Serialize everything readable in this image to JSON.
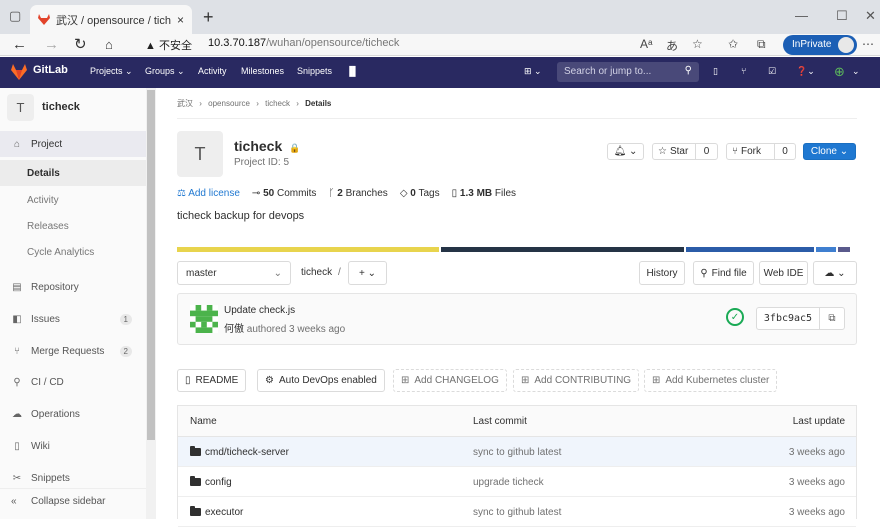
{
  "browser": {
    "tab_title": "武汉 / opensource / ticheck · Git",
    "tab_close": "×",
    "new_tab": "+",
    "security_label": "不安全",
    "url_host": "10.3.70.187",
    "url_path": "/wuhan/opensource/ticheck",
    "inprivate_label": "InPrivate"
  },
  "header": {
    "brand": "GitLab",
    "projects": "Projects ⌄",
    "groups": "Groups ⌄",
    "activity": "Activity",
    "milestones": "Milestones",
    "snippets": "Snippets",
    "search_placeholder": "Search or jump to..."
  },
  "sidebar": {
    "project_initial": "T",
    "project_name": "ticheck",
    "project": "Project",
    "details": "Details",
    "activity": "Activity",
    "releases": "Releases",
    "cycle_analytics": "Cycle Analytics",
    "repository": "Repository",
    "issues": "Issues",
    "issues_count": "1",
    "merge_requests": "Merge Requests",
    "merge_requests_count": "2",
    "ci_cd": "CI / CD",
    "operations": "Operations",
    "wiki": "Wiki",
    "snippets": "Snippets",
    "collapse": "Collapse sidebar"
  },
  "breadcrumb": {
    "group": "武汉",
    "subgroup": "opensource",
    "project": "ticheck",
    "current": "Details"
  },
  "project": {
    "initial": "T",
    "name": "ticheck",
    "id_text": "Project ID: 5",
    "star_label": "Star",
    "star_count": "0",
    "fork_label": "Fork",
    "fork_count": "0",
    "clone_label": "Clone ⌄",
    "add_license": "Add license",
    "commits": "50",
    "commits_label": "Commits",
    "branches": "2",
    "branches_label": "Branches",
    "tags": "0",
    "tags_label": "Tags",
    "files_size": "1.3 MB",
    "files_label": "Files",
    "description": "ticheck backup for devops",
    "language_colors": [
      "#e8d44d",
      "#253446",
      "#2b5ca8",
      "#3f7fd0",
      "#5a5a8c"
    ]
  },
  "repo_controls": {
    "branch": "master",
    "path": "ticheck",
    "path_sep": "/",
    "add": "+ ⌄",
    "history": "History",
    "find_file": "Find file",
    "web_ide": "Web IDE"
  },
  "last_commit": {
    "title": "Update check.js",
    "author": "何傲",
    "meta": "authored 3 weeks ago",
    "sha": "3fbc9ac5"
  },
  "quick_actions": {
    "readme": "README",
    "auto_devops": "Auto DevOps enabled",
    "add_changelog": "Add CHANGELOG",
    "add_contributing": "Add CONTRIBUTING",
    "add_k8s": "Add Kubernetes cluster"
  },
  "file_tree": {
    "headers": {
      "name": "Name",
      "last_commit": "Last commit",
      "last_update": "Last update"
    },
    "rows": [
      {
        "name": "cmd/ticheck-server",
        "commit": "sync to github latest",
        "updated": "3 weeks ago"
      },
      {
        "name": "config",
        "commit": "upgrade ticheck",
        "updated": "3 weeks ago"
      },
      {
        "name": "executor",
        "commit": "sync to github latest",
        "updated": "3 weeks ago"
      }
    ]
  }
}
